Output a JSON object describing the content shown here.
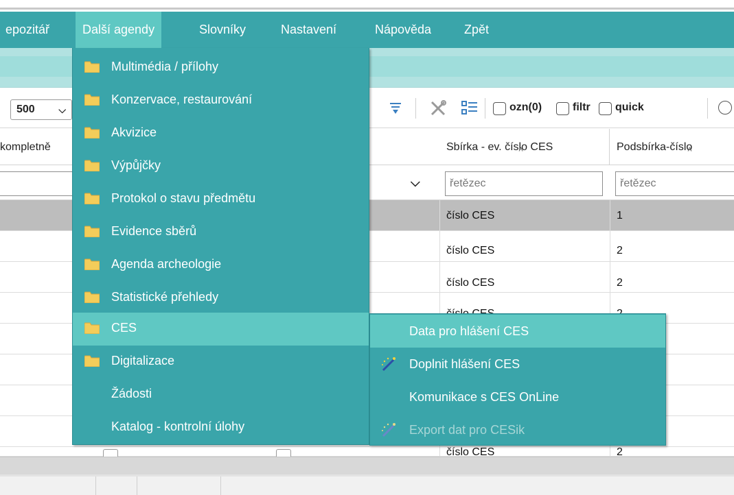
{
  "menubar": {
    "items": [
      "epozitář",
      "Další agendy",
      "Slovníky",
      "Nastavení",
      "Nápověda",
      "Zpět"
    ],
    "active": "Další agendy"
  },
  "toolbar": {
    "page_size": "500",
    "checkboxes": [
      {
        "label": "ozn(0)",
        "checked": false
      },
      {
        "label": "filtr",
        "checked": false
      },
      {
        "label": "quick",
        "checked": false
      }
    ]
  },
  "table": {
    "columns": [
      "kompletně",
      "Sbírka - ev. číslo CES",
      "Podsbírka-číslo"
    ],
    "filters": {
      "sbirka_placeholder": "řetězec",
      "podsbirka_placeholder": "řetězec"
    },
    "rows": [
      {
        "sbirka": "číslo CES",
        "podsbirka": "1"
      },
      {
        "sbirka": "číslo CES",
        "podsbirka": "2"
      },
      {
        "sbirka": "číslo CES",
        "podsbirka": "2"
      },
      {
        "sbirka": "číslo CES",
        "podsbirka": "2"
      }
    ],
    "partial_row": {
      "sbirka": "číslo CES",
      "podsbirka": "2"
    }
  },
  "dropdown": {
    "items": [
      {
        "label": "Multimédia / přílohy",
        "icon": "folder-icon"
      },
      {
        "label": "Konzervace, restaurování",
        "icon": "folder-icon"
      },
      {
        "label": "Akvizice",
        "icon": "folder-icon"
      },
      {
        "label": "Výpůjčky",
        "icon": "folder-icon"
      },
      {
        "label": "Protokol o stavu předmětu",
        "icon": "folder-icon"
      },
      {
        "label": "Evidence sběrů",
        "icon": "folder-icon"
      },
      {
        "label": "Agenda archeologie",
        "icon": "folder-icon"
      },
      {
        "label": "Statistické přehledy",
        "icon": "folder-icon"
      },
      {
        "label": "CES",
        "icon": "folder-icon",
        "hover": true
      },
      {
        "label": "Digitalizace",
        "icon": "folder-icon"
      },
      {
        "label": "Žádosti",
        "icon": null
      },
      {
        "label": "Katalog - kontrolní úlohy",
        "icon": null
      }
    ]
  },
  "submenu": {
    "items": [
      {
        "label": "Data pro hlášení CES",
        "icon": null,
        "hover": true
      },
      {
        "label": "Doplnit hlášení CES",
        "icon": "magic-wand-icon"
      },
      {
        "label": "Komunikace s CES OnLine",
        "icon": null
      },
      {
        "label": "Export dat pro CESik",
        "icon": "magic-wand-icon",
        "disabled": true
      }
    ]
  },
  "colors": {
    "menu_bg": "#3aa5aa",
    "menu_hover": "#5fc8c3",
    "light_band": "#b2e2e1",
    "selected_row": "#bdbdbd",
    "folder": "#f3cd5a"
  }
}
